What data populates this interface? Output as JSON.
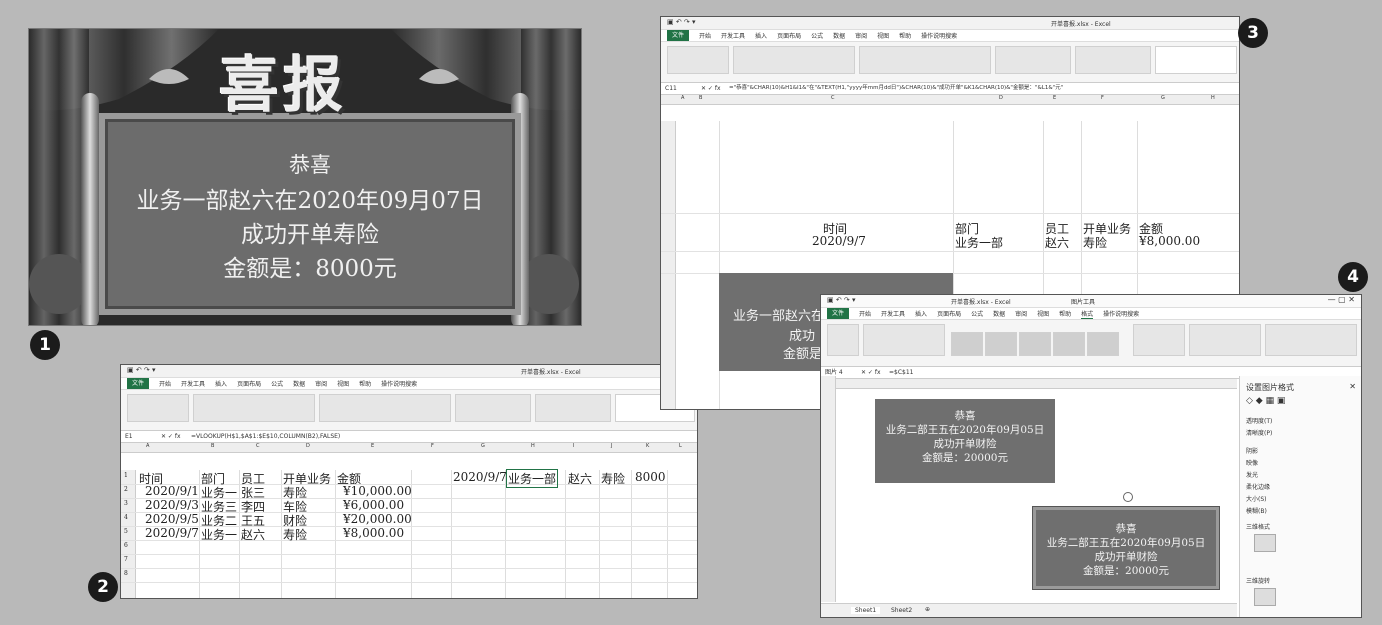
{
  "panel1": {
    "headline": "喜报",
    "line1": "恭喜",
    "line2": "业务一部赵六在2020年09月07日",
    "line3": "成功开单寿险",
    "line4": "金额是：8000元"
  },
  "badges": [
    "1",
    "2",
    "3",
    "4"
  ],
  "panel2": {
    "title": "开单喜报.xlsx - Excel",
    "menu": [
      "文件",
      "开始",
      "开发工具",
      "插入",
      "页面布局",
      "公式",
      "数据",
      "审阅",
      "视图",
      "帮助",
      "操作说明搜索"
    ],
    "name_box": "E1",
    "formula": "=VLOOKUP(H$1,$A$1:$E$10,COLUMN(B2),FALSE)",
    "columns": [
      "A",
      "B",
      "C",
      "D",
      "E",
      "F",
      "G",
      "H",
      "I",
      "J",
      "K",
      "L"
    ],
    "headers": [
      "时间",
      "部门",
      "员工",
      "开单业务",
      "金额"
    ],
    "rows": [
      [
        "2020/9/1",
        "业务一",
        "张三",
        "寿险",
        "¥10,000.00"
      ],
      [
        "2020/9/3",
        "业务三",
        "李四",
        "车险",
        "¥6,000.00"
      ],
      [
        "2020/9/5",
        "业务二",
        "王五",
        "财险",
        "¥20,000.00"
      ],
      [
        "2020/9/7",
        "业务一",
        "赵六",
        "寿险",
        "¥8,000.00"
      ]
    ],
    "lookup": [
      "2020/9/7",
      "业务一部",
      "赵六",
      "寿险",
      "8000"
    ],
    "row_numbers": [
      "1",
      "2",
      "3",
      "4",
      "5",
      "6",
      "7",
      "8"
    ]
  },
  "panel3": {
    "title": "开单喜报.xlsx - Excel",
    "menu": [
      "文件",
      "开始",
      "开发工具",
      "插入",
      "页面布局",
      "公式",
      "数据",
      "审阅",
      "视图",
      "帮助",
      "操作说明搜索"
    ],
    "name_box": "C11",
    "formula": "=\"恭喜\"&CHAR(10)&H1&I1&\"在\"&TEXT(H1,\"yyyy年mm月dd日\")&CHAR(10)&\"成功开单\"&K1&CHAR(10)&\"金额是：\"&L1&\"元\"",
    "col_labels": [
      "A",
      "B",
      "C",
      "D",
      "E",
      "F",
      "G",
      "H"
    ],
    "labels": [
      "时间",
      "部门",
      "员工",
      "开单业务",
      "金额"
    ],
    "values": [
      "2020/9/7",
      "业务一部",
      "赵六",
      "寿险",
      "¥8,000.00"
    ],
    "shape_lines": [
      "业务一部赵六在",
      "成功",
      "金额是"
    ]
  },
  "panel4": {
    "title": "开单喜报.xlsx - Excel",
    "context_tab": "图片工具",
    "menu": [
      "文件",
      "开始",
      "开发工具",
      "插入",
      "页面布局",
      "公式",
      "数据",
      "审阅",
      "视图",
      "帮助",
      "格式",
      "操作说明搜索"
    ],
    "name_box": "图片 4",
    "formula": "=$C$11",
    "pane_title": "设置图片格式",
    "pane_props": [
      "透明度(T)",
      "清晰度(P)",
      "阴影",
      "映像",
      "发光",
      "柔化边缘",
      "大小(S)",
      "模糊(B)",
      "三维格式",
      "三维旋转"
    ],
    "src_lines": [
      "恭喜",
      "业务二部王五在2020年09月05日",
      "成功开单财险",
      "金额是：20000元"
    ],
    "pic_lines": [
      "恭喜",
      "业务二部王五在2020年09月05日",
      "成功开单财险",
      "金额是：20000元"
    ],
    "sheets": [
      "Sheet1",
      "Sheet2"
    ]
  }
}
